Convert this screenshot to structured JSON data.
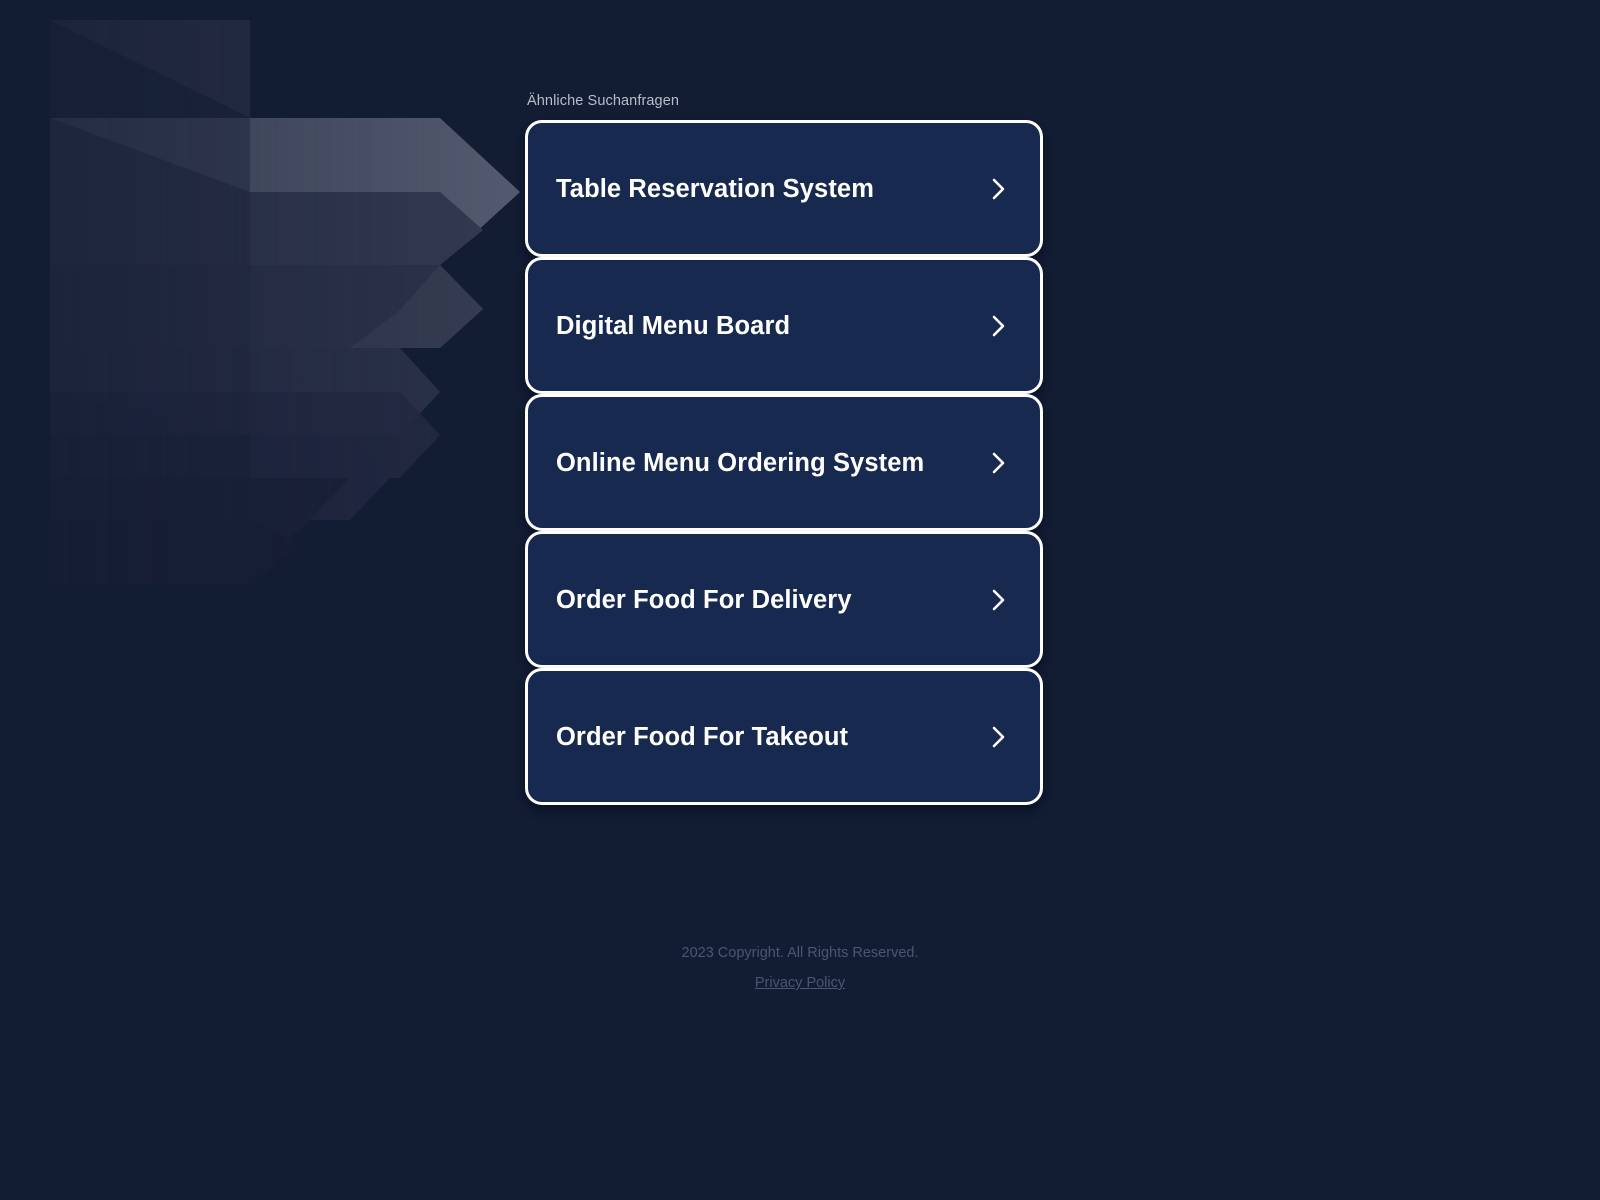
{
  "page": {
    "background_color": "#121c33",
    "card_fill_color": "#17294f",
    "card_border_color": "#ffffff"
  },
  "results": {
    "section_label": "Ähnliche Suchanfragen",
    "items": [
      {
        "title": "Table Reservation System",
        "chevron": "chevron-right-icon"
      },
      {
        "title": "Digital Menu Board",
        "chevron": "chevron-right-icon"
      },
      {
        "title": "Online Menu Ordering System",
        "chevron": "chevron-right-icon"
      },
      {
        "title": "Order Food For Delivery",
        "chevron": "chevron-right-icon"
      },
      {
        "title": "Order Food For Takeout",
        "chevron": "chevron-right-icon"
      }
    ]
  },
  "footer": {
    "copyright": "2023 Copyright. All Rights Reserved.",
    "privacy_label": "Privacy Policy"
  },
  "decoration": {
    "band_colors": [
      "#6a6f83",
      "#4a4d5e",
      "#343a50",
      "#272c45",
      "#1c2239"
    ]
  }
}
